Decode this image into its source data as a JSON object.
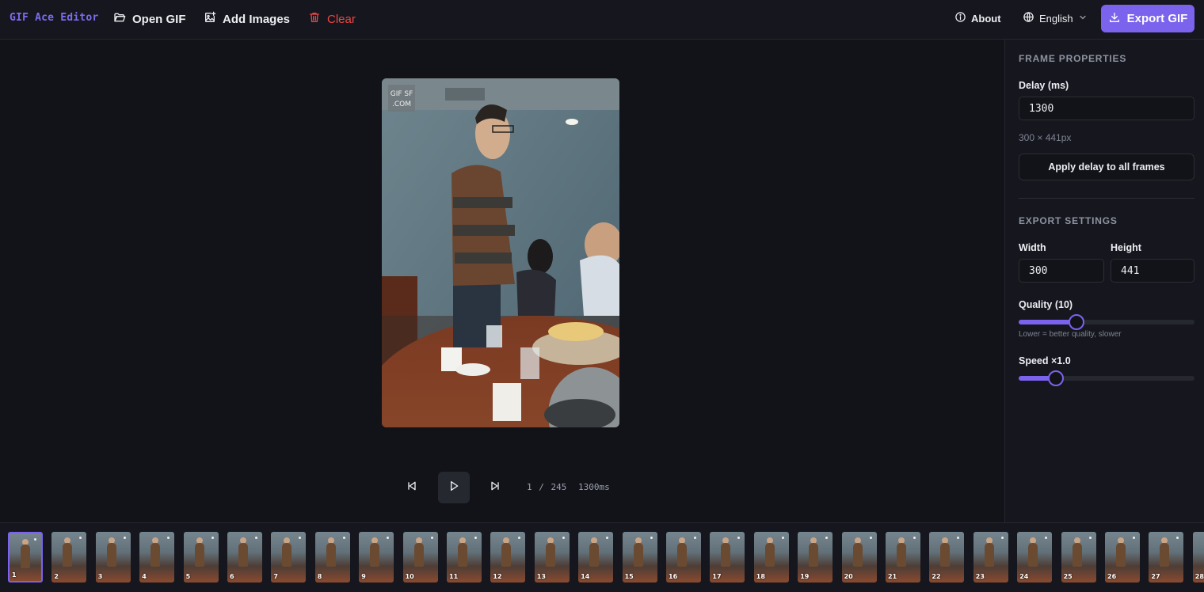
{
  "header": {
    "brand": "GIF Ace Editor",
    "open_gif": "Open GIF",
    "add_images": "Add Images",
    "clear": "Clear",
    "about": "About",
    "language": "English",
    "export_gif": "Export GIF"
  },
  "preview": {
    "watermark_line1": "GIF SF",
    "watermark_line2": ".COM"
  },
  "playback": {
    "counter": "1 / 245",
    "delay_readout": "1300ms"
  },
  "frame_properties": {
    "title": "FRAME PROPERTIES",
    "delay_label": "Delay (ms)",
    "delay_value": "1300",
    "dimensions": "300 × 441px",
    "apply_all": "Apply delay to all frames"
  },
  "export_settings": {
    "title": "EXPORT SETTINGS",
    "width_label": "Width",
    "width_value": "300",
    "height_label": "Height",
    "height_value": "441",
    "quality_label": "Quality (10)",
    "quality_fraction": 0.33,
    "quality_hint": "Lower = better quality, slower",
    "speed_label": "Speed ×1.0",
    "speed_fraction": 0.21
  },
  "filmstrip": {
    "visible_frames": [
      "1",
      "2",
      "3",
      "4",
      "5",
      "6",
      "7",
      "8",
      "9",
      "10",
      "11",
      "12",
      "13",
      "14",
      "15",
      "16",
      "17",
      "18",
      "19",
      "20",
      "21",
      "22",
      "23",
      "24",
      "25",
      "26",
      "27",
      "28"
    ],
    "selected": "1"
  },
  "colors": {
    "accent": "#7b63ee",
    "danger": "#ef4444",
    "background": "#121319"
  }
}
